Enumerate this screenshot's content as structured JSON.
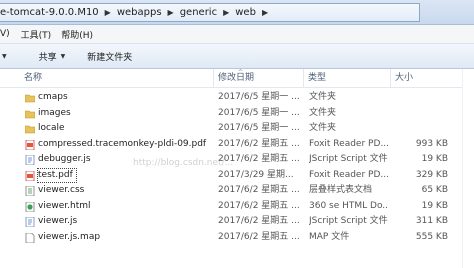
{
  "address": {
    "crumbs": [
      "e-tomcat-9.0.0.M10",
      "webapps",
      "generic",
      "web"
    ],
    "separator": "▶"
  },
  "menubar": {
    "items": [
      "V)",
      "工具(T)",
      "帮助(H)"
    ]
  },
  "toolbar": {
    "share_label": "共享",
    "new_folder_label": "新建文件夹"
  },
  "columns": {
    "name": "名称",
    "date": "修改日期",
    "type": "类型",
    "size": "大小"
  },
  "files": [
    {
      "name": "cmaps",
      "date": "2017/6/5 星期一 ...",
      "type": "文件夹",
      "size": "",
      "icon": "folder-icon"
    },
    {
      "name": "images",
      "date": "2017/6/5 星期一 ...",
      "type": "文件夹",
      "size": "",
      "icon": "folder-icon"
    },
    {
      "name": "locale",
      "date": "2017/6/5 星期一 ...",
      "type": "文件夹",
      "size": "",
      "icon": "folder-icon"
    },
    {
      "name": "compressed.tracemonkey-pldi-09.pdf",
      "date": "2017/6/2 星期五 ...",
      "type": "Foxit Reader PD...",
      "size": "993 KB",
      "icon": "pdf-icon"
    },
    {
      "name": "debugger.js",
      "date": "2017/6/2 星期五 ...",
      "type": "JScript Script 文件",
      "size": "19 KB",
      "icon": "script-icon"
    },
    {
      "name": "test.pdf",
      "date": "2017/3/29 星期...",
      "type": "Foxit Reader PD...",
      "size": "329 KB",
      "icon": "pdf-icon"
    },
    {
      "name": "viewer.css",
      "date": "2017/6/2 星期五 ...",
      "type": "层叠样式表文档",
      "size": "65 KB",
      "icon": "css-icon"
    },
    {
      "name": "viewer.html",
      "date": "2017/6/2 星期五 ...",
      "type": "360 se HTML Do...",
      "size": "19 KB",
      "icon": "html-icon"
    },
    {
      "name": "viewer.js",
      "date": "2017/6/2 星期五 ...",
      "type": "JScript Script 文件",
      "size": "311 KB",
      "icon": "script-icon"
    },
    {
      "name": "viewer.js.map",
      "date": "2017/6/2 星期五 ...",
      "type": "MAP 文件",
      "size": "555 KB",
      "icon": "file-icon"
    }
  ],
  "watermark": "http://blog.csdn.net/...",
  "colors": {
    "folder": "#e8c25c",
    "pdf": "#e0573a",
    "script": "#4a78c2"
  }
}
